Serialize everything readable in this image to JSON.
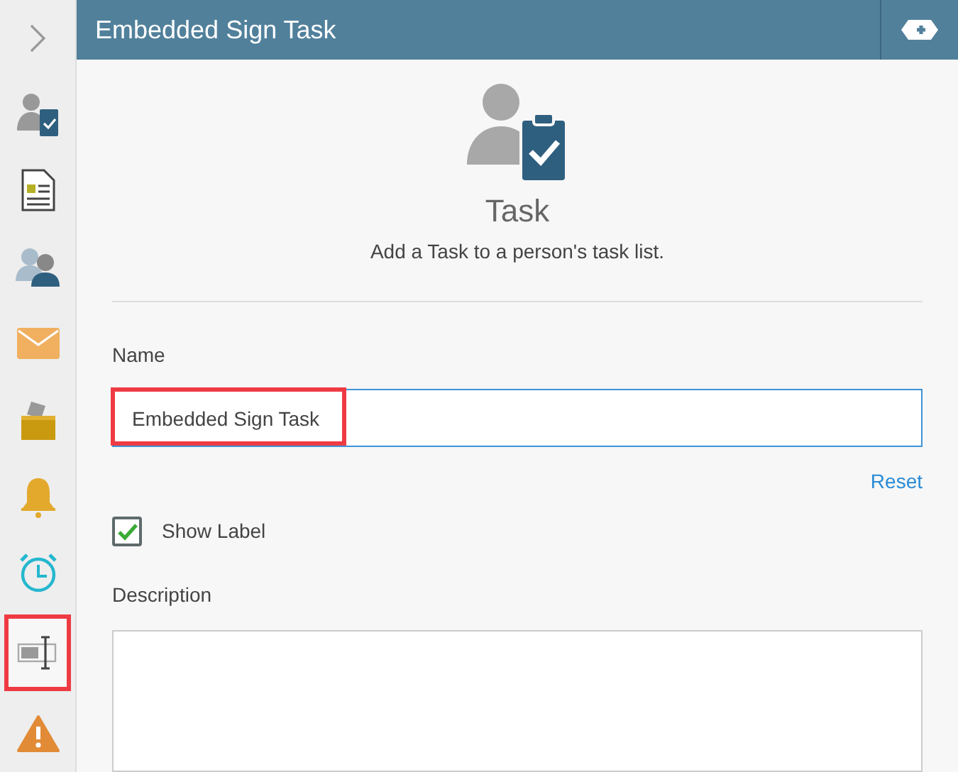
{
  "sidebar": {
    "items": [
      {
        "kind": "expand",
        "selected": false
      },
      {
        "kind": "task",
        "selected": false
      },
      {
        "kind": "form",
        "selected": false
      },
      {
        "kind": "people",
        "selected": false
      },
      {
        "kind": "email",
        "selected": false
      },
      {
        "kind": "ballot",
        "selected": false
      },
      {
        "kind": "alert",
        "selected": false
      },
      {
        "kind": "timer",
        "selected": false
      },
      {
        "kind": "textbox",
        "selected": true
      },
      {
        "kind": "warning",
        "selected": false
      }
    ]
  },
  "header": {
    "title": "Embedded Sign Task"
  },
  "intro": {
    "title": "Task",
    "description": "Add a Task to a person's task list."
  },
  "name_field": {
    "label": "Name",
    "value": "Embedded Sign Task",
    "highlighted": true
  },
  "reset_link": "Reset",
  "show_label": {
    "label": "Show Label",
    "checked": true
  },
  "description_field": {
    "label": "Description"
  }
}
